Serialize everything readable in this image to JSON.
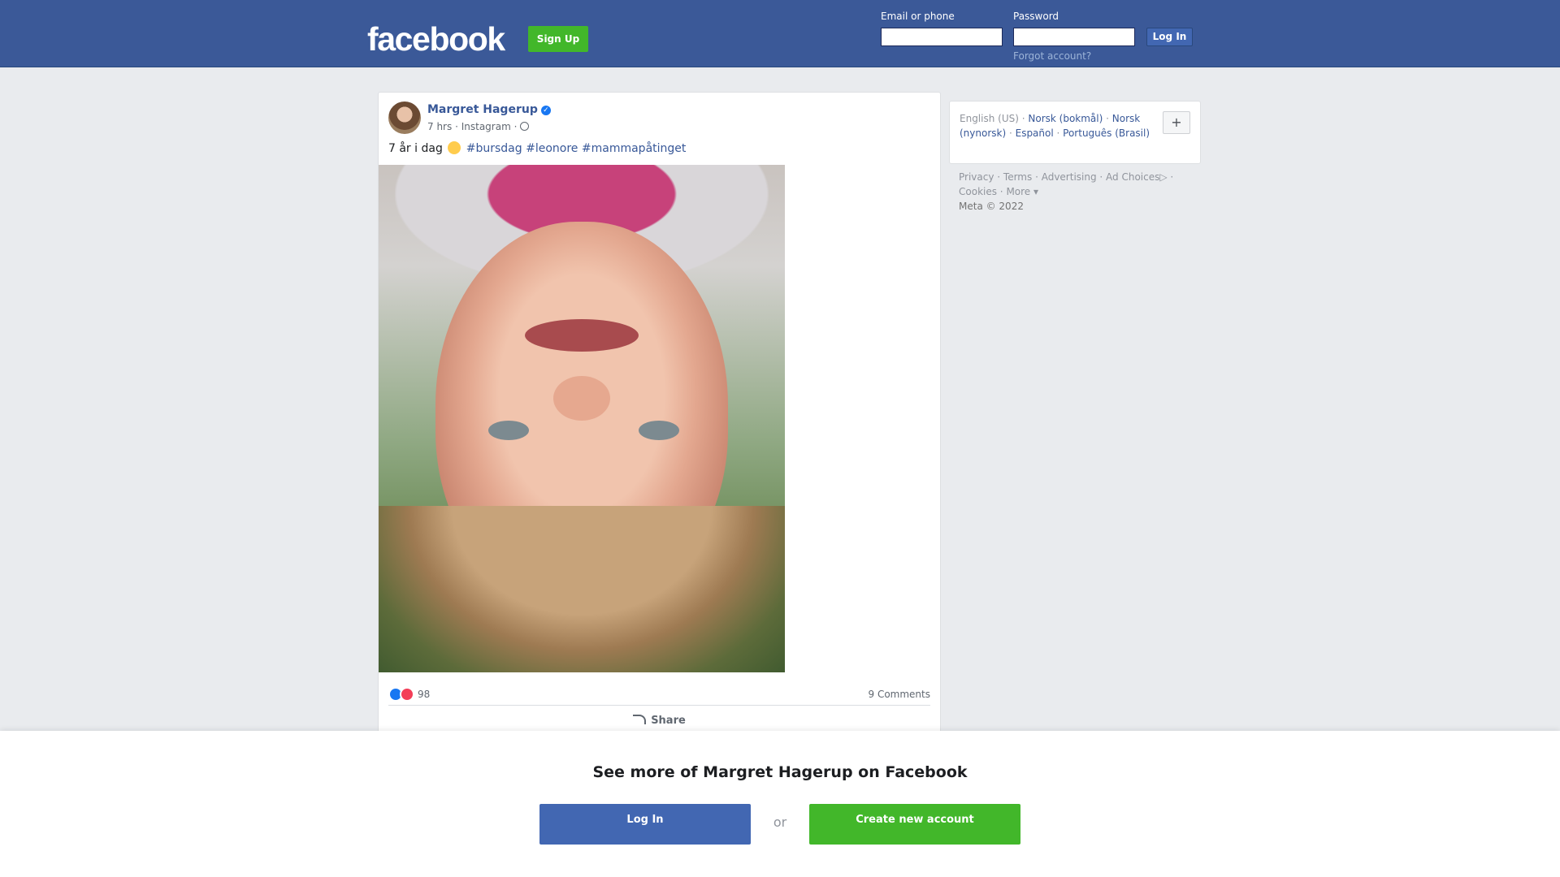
{
  "header": {
    "logo": "facebook",
    "signup_label": "Sign Up",
    "email_label": "Email or phone",
    "password_label": "Password",
    "login_label": "Log In",
    "forgot_label": "Forgot account?"
  },
  "post": {
    "author": "Margret Hagerup",
    "time": "7 hrs",
    "source": "Instagram",
    "text_prefix": "7 år i dag",
    "hashtags": [
      "#bursdag",
      "#leonore",
      "#mammapåtinget"
    ],
    "reaction_count": "98",
    "comments_label": "9 Comments",
    "share_label": "Share"
  },
  "sidebar": {
    "languages": [
      "English (US)",
      "Norsk (bokmål)",
      "Norsk (nynorsk)",
      "Español",
      "Português (Brasil)"
    ],
    "add_language": "+",
    "footer_links": [
      "Privacy",
      "Terms",
      "Advertising",
      "Ad Choices",
      "Cookies",
      "More"
    ],
    "copyright": "Meta © 2022"
  },
  "overlay": {
    "title": "See more of Margret Hagerup on Facebook",
    "login_label": "Log In",
    "or_label": "or",
    "create_label": "Create new account"
  },
  "colors": {
    "brand_blue": "#3b5998",
    "link_blue": "#385898",
    "green": "#42b72a",
    "button_blue": "#4267b2"
  }
}
